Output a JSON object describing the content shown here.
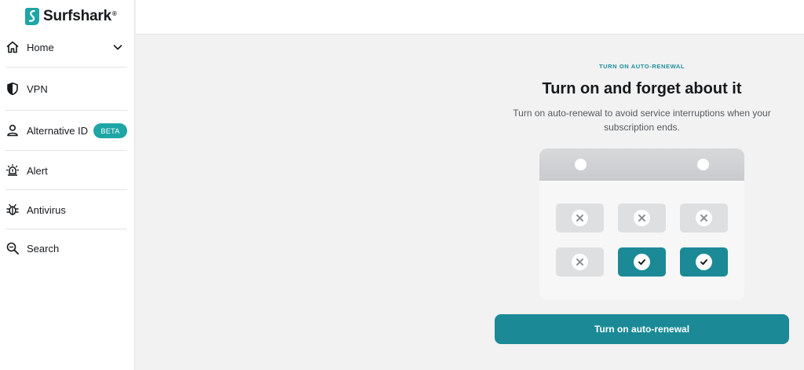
{
  "brand": {
    "name": "Surfshark",
    "reg_mark": "®",
    "logo_color": "#1ea5a5"
  },
  "sidebar": {
    "items": [
      {
        "label": "Home",
        "icon": "home-icon",
        "expandable": true
      },
      {
        "label": "VPN",
        "icon": "shield-icon"
      },
      {
        "label": "Alternative ID",
        "icon": "person-icon",
        "badge": "BETA"
      },
      {
        "label": "Alert",
        "icon": "alert-icon"
      },
      {
        "label": "Antivirus",
        "icon": "bug-icon"
      },
      {
        "label": "Search",
        "icon": "search-icon"
      }
    ]
  },
  "main": {
    "eyebrow": "TURN ON AUTO-RENEWAL",
    "title": "Turn on and forget about it",
    "description": "Turn on auto-renewal to avoid service interruptions when your subscription ends.",
    "calendar_cells": [
      "x-icon",
      "x-icon",
      "x-icon",
      "x-icon",
      "check-icon",
      "check-icon"
    ],
    "cta_label": "Turn on auto-renewal"
  },
  "colors": {
    "accent": "#1b8a96",
    "badge": "#1ea5a5",
    "background": "#f2f2f2"
  }
}
